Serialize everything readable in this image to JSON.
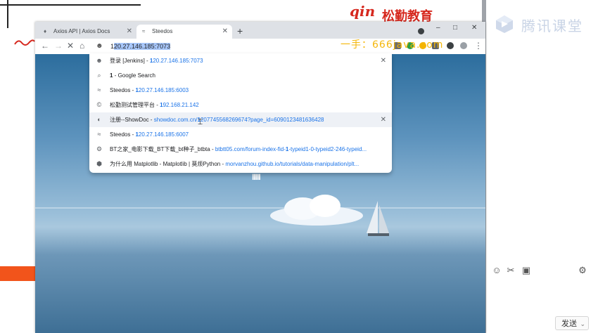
{
  "slide": {
    "brand_mark": "qin",
    "brand_name": "松勤教育"
  },
  "watermark": "一手：666java.com",
  "sidebar": {
    "logo_text": "腾讯课堂",
    "send_label": "发送",
    "send_caret": "⌄",
    "tools": {
      "emoji": "☺",
      "scissors": "✂",
      "image": "▣",
      "settings": "⚙"
    }
  },
  "browser": {
    "tabs": [
      {
        "label": "Axios API | Axios Docs",
        "favicon": "♦"
      },
      {
        "label": "Steedos",
        "favicon": "≈"
      }
    ],
    "new_tab": "+",
    "window_controls": {
      "minimize": "–",
      "maximize": "□",
      "close": "✕"
    },
    "nav": {
      "back": "←",
      "forward": "→",
      "stop": "✕",
      "home": "⌂"
    },
    "omnibox": {
      "typed": "1",
      "autocomplete": "20.27.146.185:7073"
    },
    "page_logo": "IIIII",
    "menu": "⋮"
  },
  "suggestions": [
    {
      "icon": "jenkins-icon",
      "glyph": "☻",
      "title": "登录 [Jenkins]",
      "sep": " - ",
      "url_bold": "1",
      "url_rest": "20.27.146.185:7073",
      "removable": true,
      "highlighted": false
    },
    {
      "icon": "search-icon",
      "glyph": "⌕",
      "title": "",
      "sep": "",
      "plain_bold": "1",
      "plain_rest": " - Google Search",
      "removable": false,
      "highlighted": false
    },
    {
      "icon": "steedos-icon",
      "glyph": "≈",
      "title": "Steedos",
      "sep": " - ",
      "url_bold": "1",
      "url_rest": "20.27.146.185:6003",
      "removable": false,
      "highlighted": false
    },
    {
      "icon": "copyright-icon",
      "glyph": "©",
      "title": "松勤测试管理平台",
      "sep": " - ",
      "url_bold": "1",
      "url_rest": "92.168.21.142",
      "removable": false,
      "highlighted": false
    },
    {
      "icon": "showdoc-icon",
      "glyph": "◐",
      "title": "注册--ShowDoc",
      "sep": " - ",
      "url_pre": "showdoc.com.cn/",
      "url_bold": "1",
      "url_rest": "207745568269674?page_id=6090123481636428",
      "removable": true,
      "highlighted": true
    },
    {
      "icon": "steedos-icon",
      "glyph": "≈",
      "title": "Steedos",
      "sep": " - ",
      "url_bold": "1",
      "url_rest": "20.27.146.185:6007",
      "removable": false,
      "highlighted": false
    },
    {
      "icon": "gear-icon",
      "glyph": "⚙",
      "title": "BT之家_电影下载_BT下载_bt种子_btbta",
      "sep": " - ",
      "url_pre": "btbtt05.com/forum-index-fid-",
      "url_bold": "1",
      "url_rest": "-typeid1-0-typeid2-246-typeid...",
      "removable": false,
      "highlighted": false
    },
    {
      "icon": "python-icon",
      "glyph": "⬢",
      "title": "为什么用 Matplotlib - Matplotlib | 莫烦Python",
      "sep": " - ",
      "url_pre": "morvanzhou.github.io/tutorials/data-manipulation/plt...",
      "url_bold": "",
      "url_rest": "",
      "removable": false,
      "highlighted": false
    }
  ],
  "colors": {
    "accent": "#1a73e8",
    "brand_red": "#d6281e",
    "watermark": "#f4b400"
  }
}
